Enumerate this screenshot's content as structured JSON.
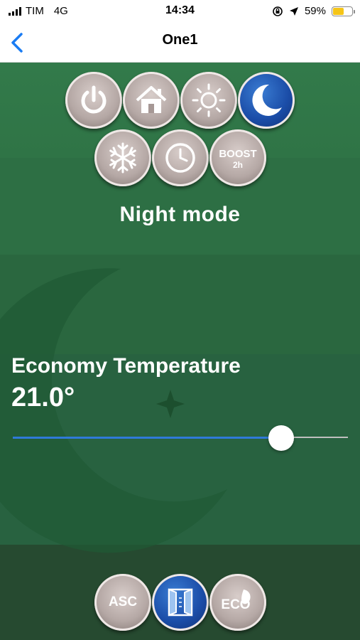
{
  "status_bar": {
    "carrier": "TIM",
    "network": "4G",
    "time": "14:34",
    "battery_percent": "59%",
    "battery_level": 0.59,
    "icons": [
      "signal-icon",
      "rotation-lock-icon",
      "location-arrow-icon",
      "battery-icon"
    ]
  },
  "nav": {
    "title": "One1",
    "back_icon": "chevron-left-icon"
  },
  "modes": {
    "buttons": [
      {
        "id": "power",
        "icon": "power-icon"
      },
      {
        "id": "home",
        "icon": "home-icon"
      },
      {
        "id": "day",
        "icon": "sun-icon"
      },
      {
        "id": "night",
        "icon": "moon-icon",
        "active": true
      },
      {
        "id": "antifreeze",
        "icon": "snowflake-icon"
      },
      {
        "id": "schedule",
        "icon": "clock-icon"
      },
      {
        "id": "boost",
        "icon": "boost-icon",
        "text": "BOOST",
        "subtext": "2h"
      }
    ],
    "current_label": "Night mode"
  },
  "temperature": {
    "label": "Economy Temperature",
    "value": "21.0°",
    "slider_fraction": 0.8
  },
  "bottom": {
    "buttons": [
      {
        "id": "asc",
        "text": "ASC"
      },
      {
        "id": "window",
        "icon": "window-icon",
        "active": true
      },
      {
        "id": "eco",
        "text": "ECO",
        "icon": "leaf-icon"
      }
    ]
  },
  "colors": {
    "accent": "#2f7ad8",
    "active_button": "#1b4da8",
    "background_green": "#2f7347",
    "battery": "#f5c518"
  }
}
